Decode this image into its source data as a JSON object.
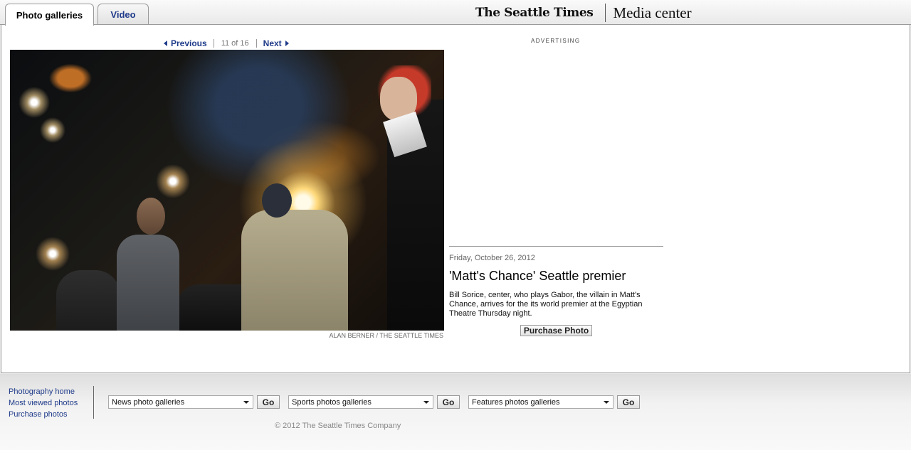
{
  "tabs": [
    {
      "label": "Photo galleries",
      "active": true
    },
    {
      "label": "Video",
      "active": false
    }
  ],
  "brand": {
    "logo_text": "The Seattle Times",
    "section_title": "Media center"
  },
  "pager": {
    "previous_label": "Previous",
    "count": "11 of 16",
    "next_label": "Next"
  },
  "photo": {
    "credit": "ALAN BERNER / THE SEATTLE TIMES"
  },
  "ad": {
    "label": "ADVERTISING"
  },
  "caption": {
    "date": "Friday, October 26, 2012",
    "title": "'Matt's Chance' Seattle premier",
    "text": "Bill Sorice, center, who plays Gabor, the villain in Matt's Chance, arrives for the its world premier at the Egyptian Theatre Thursday night.",
    "purchase_label": "Purchase Photo"
  },
  "footer": {
    "links": [
      "Photography home",
      "Most viewed photos",
      "Purchase photos"
    ],
    "selects": [
      {
        "value": "News photo galleries",
        "button": "Go"
      },
      {
        "value": "Sports photos galleries",
        "button": "Go"
      },
      {
        "value": "Features photos galleries",
        "button": "Go"
      }
    ],
    "copyright": "© 2012 The Seattle Times Company"
  },
  "colors": {
    "link": "#1f3b8a",
    "border": "#9a9a9a",
    "background": "#ececec"
  }
}
